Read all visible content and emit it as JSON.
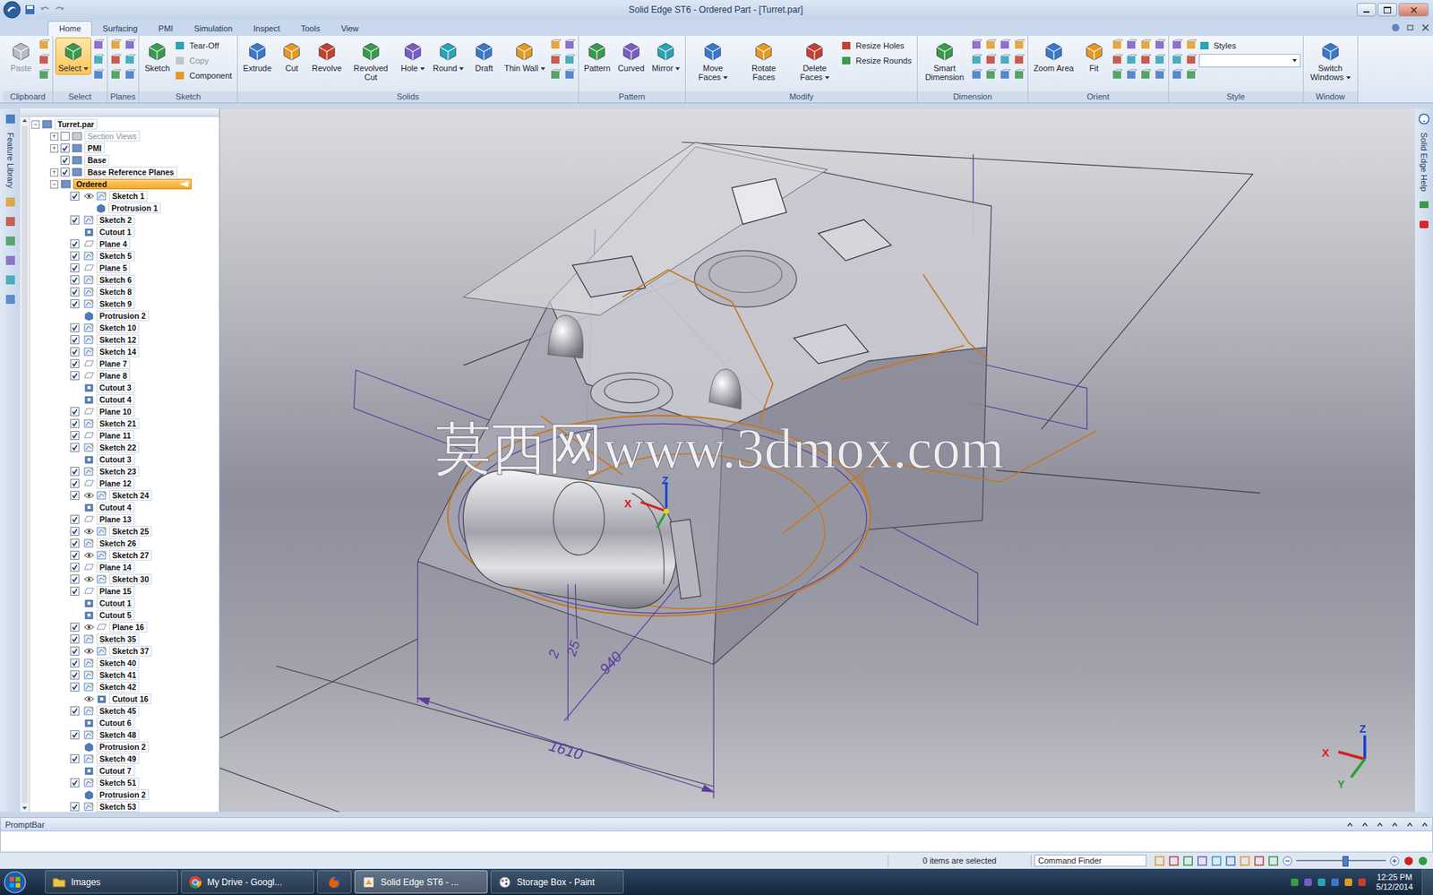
{
  "window": {
    "title": "Solid Edge ST6 - Ordered Part - [Turret.par]"
  },
  "ribbon_tabs": [
    {
      "label": "Home",
      "selected": true
    },
    {
      "label": "Surfacing",
      "selected": false
    },
    {
      "label": "PMI",
      "selected": false
    },
    {
      "label": "Simulation",
      "selected": false
    },
    {
      "label": "Inspect",
      "selected": false
    },
    {
      "label": "Tools",
      "selected": false
    },
    {
      "label": "View",
      "selected": false
    }
  ],
  "ribbon_groups": [
    {
      "label": "Clipboard",
      "items": [
        {
          "kind": "large",
          "label": "Paste",
          "disabled": true,
          "selected": false,
          "dropdown": false
        }
      ]
    },
    {
      "label": "Select",
      "items": [
        {
          "kind": "large",
          "label": "Select",
          "disabled": false,
          "selected": true,
          "dropdown": true
        }
      ]
    },
    {
      "label": "Planes",
      "items": []
    },
    {
      "label": "Sketch",
      "items": [
        {
          "kind": "large",
          "label": "Sketch",
          "disabled": false,
          "selected": false,
          "dropdown": false
        },
        {
          "kind": "small",
          "label": "Tear-Off",
          "disabled": false
        },
        {
          "kind": "small",
          "label": "Copy",
          "disabled": true
        },
        {
          "kind": "small",
          "label": "Component",
          "disabled": false
        }
      ]
    },
    {
      "label": "Solids",
      "items": [
        {
          "kind": "large",
          "label": "Extrude",
          "disabled": false,
          "selected": false,
          "dropdown": false
        },
        {
          "kind": "large",
          "label": "Cut",
          "disabled": false,
          "selected": false,
          "dropdown": false
        },
        {
          "kind": "large",
          "label": "Revolve",
          "disabled": false,
          "selected": false,
          "dropdown": false
        },
        {
          "kind": "large",
          "label": "Revolved Cut",
          "disabled": false,
          "selected": false,
          "dropdown": false
        },
        {
          "kind": "large",
          "label": "Hole",
          "disabled": false,
          "selected": false,
          "dropdown": true
        },
        {
          "kind": "large",
          "label": "Round",
          "disabled": false,
          "selected": false,
          "dropdown": true
        },
        {
          "kind": "large",
          "label": "Draft",
          "disabled": false,
          "selected": false,
          "dropdown": false
        },
        {
          "kind": "large",
          "label": "Thin Wall",
          "disabled": false,
          "selected": false,
          "dropdown": true
        }
      ]
    },
    {
      "label": "Pattern",
      "items": [
        {
          "kind": "large",
          "label": "Pattern",
          "disabled": false,
          "selected": false,
          "dropdown": false
        },
        {
          "kind": "large",
          "label": "Curved",
          "disabled": false,
          "selected": false,
          "dropdown": false
        },
        {
          "kind": "large",
          "label": "Mirror",
          "disabled": false,
          "selected": false,
          "dropdown": true
        }
      ]
    },
    {
      "label": "Modify",
      "items": [
        {
          "kind": "large",
          "label": "Move Faces",
          "disabled": false,
          "selected": false,
          "dropdown": true
        },
        {
          "kind": "large",
          "label": "Rotate Faces",
          "disabled": false,
          "selected": false,
          "dropdown": false
        },
        {
          "kind": "large",
          "label": "Delete Faces",
          "disabled": false,
          "selected": false,
          "dropdown": true
        },
        {
          "kind": "small",
          "label": "Resize Holes",
          "disabled": false
        },
        {
          "kind": "small",
          "label": "Resize Rounds",
          "disabled": false
        }
      ]
    },
    {
      "label": "Dimension",
      "items": [
        {
          "kind": "large",
          "label": "Smart Dimension",
          "disabled": false,
          "selected": false,
          "dropdown": false
        }
      ]
    },
    {
      "label": "Orient",
      "items": [
        {
          "kind": "large",
          "label": "Zoom Area",
          "disabled": false,
          "selected": false,
          "dropdown": false
        },
        {
          "kind": "large",
          "label": "Fit",
          "disabled": false,
          "selected": false,
          "dropdown": false
        }
      ]
    },
    {
      "label": "Style",
      "items": [
        {
          "kind": "small",
          "label": "Styles",
          "disabled": false
        },
        {
          "kind": "combo",
          "disabled": false
        }
      ]
    },
    {
      "label": "Window",
      "items": [
        {
          "kind": "large",
          "label": "Switch Windows",
          "disabled": false,
          "selected": false,
          "dropdown": true
        }
      ]
    }
  ],
  "left_strip": {
    "label": "Feature Library"
  },
  "right_strip": {
    "label": "Solid Edge Help"
  },
  "pathfinder": {
    "top": [
      {
        "label": "Turret.par",
        "expander": "−",
        "level": 0,
        "checkbox": false,
        "checked": false,
        "disabled": false,
        "selected": false
      },
      {
        "label": "Section Views",
        "expander": "+",
        "level": 1,
        "checkbox": true,
        "checked": false,
        "disabled": true,
        "selected": false
      },
      {
        "label": "PMI",
        "expander": "+",
        "level": 1,
        "checkbox": true,
        "checked": true,
        "disabled": false,
        "selected": false
      },
      {
        "label": "Base",
        "expander": "",
        "level": 1,
        "checkbox": true,
        "checked": true,
        "disabled": false,
        "selected": false
      },
      {
        "label": "Base Reference Planes",
        "expander": "+",
        "level": 1,
        "checkbox": true,
        "checked": true,
        "disabled": false,
        "selected": false
      },
      {
        "label": "Ordered",
        "expander": "−",
        "level": 1,
        "checkbox": false,
        "checked": false,
        "disabled": false,
        "selected": true
      }
    ],
    "features": [
      {
        "label": "Sketch 1",
        "type": "sketch",
        "checkbox": true,
        "checked": true,
        "eye": true,
        "indent": 0
      },
      {
        "label": "Protrusion 1",
        "type": "protrusion",
        "checkbox": false,
        "checked": false,
        "eye": false,
        "indent": 1
      },
      {
        "label": "Sketch 2",
        "type": "sketch",
        "checkbox": true,
        "checked": true,
        "eye": false,
        "indent": 0
      },
      {
        "label": "Cutout 1",
        "type": "cutout",
        "checkbox": false,
        "checked": false,
        "eye": false,
        "indent": 0
      },
      {
        "label": "Plane 4",
        "type": "plane",
        "checkbox": true,
        "checked": true,
        "eye": false,
        "indent": 0
      },
      {
        "label": "Sketch 5",
        "type": "sketch",
        "checkbox": true,
        "checked": true,
        "eye": false,
        "indent": 0
      },
      {
        "label": "Plane 5",
        "type": "plane",
        "checkbox": true,
        "checked": true,
        "eye": false,
        "indent": 0
      },
      {
        "label": "Sketch 6",
        "type": "sketch",
        "checkbox": true,
        "checked": true,
        "eye": false,
        "indent": 0
      },
      {
        "label": "Sketch 8",
        "type": "sketch",
        "checkbox": true,
        "checked": true,
        "eye": false,
        "indent": 0
      },
      {
        "label": "Sketch 9",
        "type": "sketch",
        "checkbox": true,
        "checked": true,
        "eye": false,
        "indent": 0
      },
      {
        "label": "Protrusion 2",
        "type": "protrusion",
        "checkbox": false,
        "checked": false,
        "eye": false,
        "indent": 0
      },
      {
        "label": "Sketch 10",
        "type": "sketch",
        "checkbox": true,
        "checked": true,
        "eye": false,
        "indent": 0
      },
      {
        "label": "Sketch 12",
        "type": "sketch",
        "checkbox": true,
        "checked": true,
        "eye": false,
        "indent": 0
      },
      {
        "label": "Sketch 14",
        "type": "sketch",
        "checkbox": true,
        "checked": true,
        "eye": false,
        "indent": 0
      },
      {
        "label": "Plane 7",
        "type": "plane",
        "checkbox": true,
        "checked": true,
        "eye": false,
        "indent": 0
      },
      {
        "label": "Plane 8",
        "type": "plane",
        "checkbox": true,
        "checked": true,
        "eye": false,
        "indent": 0
      },
      {
        "label": "Cutout 3",
        "type": "cutout",
        "checkbox": false,
        "checked": false,
        "eye": false,
        "indent": 0
      },
      {
        "label": "Cutout 4",
        "type": "cutout",
        "checkbox": false,
        "checked": false,
        "eye": false,
        "indent": 0
      },
      {
        "label": "Plane 10",
        "type": "plane",
        "checkbox": true,
        "checked": true,
        "eye": false,
        "indent": 0
      },
      {
        "label": "Sketch 21",
        "type": "sketch",
        "checkbox": true,
        "checked": true,
        "eye": false,
        "indent": 0
      },
      {
        "label": "Plane 11",
        "type": "plane",
        "checkbox": true,
        "checked": true,
        "eye": false,
        "indent": 0
      },
      {
        "label": "Sketch 22",
        "type": "sketch",
        "checkbox": true,
        "checked": true,
        "eye": false,
        "indent": 0
      },
      {
        "label": "Cutout 3",
        "type": "cutout",
        "checkbox": false,
        "checked": false,
        "eye": false,
        "indent": 0
      },
      {
        "label": "Sketch 23",
        "type": "sketch",
        "checkbox": true,
        "checked": true,
        "eye": false,
        "indent": 0
      },
      {
        "label": "Plane 12",
        "type": "plane",
        "checkbox": true,
        "checked": true,
        "eye": false,
        "indent": 0
      },
      {
        "label": "Sketch 24",
        "type": "sketch",
        "checkbox": true,
        "checked": true,
        "eye": true,
        "indent": 0
      },
      {
        "label": "Cutout 4",
        "type": "cutout",
        "checkbox": false,
        "checked": false,
        "eye": false,
        "indent": 0
      },
      {
        "label": "Plane 13",
        "type": "plane",
        "checkbox": true,
        "checked": true,
        "eye": false,
        "indent": 0
      },
      {
        "label": "Sketch 25",
        "type": "sketch",
        "checkbox": true,
        "checked": true,
        "eye": true,
        "indent": 0
      },
      {
        "label": "Sketch 26",
        "type": "sketch",
        "checkbox": true,
        "checked": true,
        "eye": false,
        "indent": 0
      },
      {
        "label": "Sketch 27",
        "type": "sketch",
        "checkbox": true,
        "checked": true,
        "eye": true,
        "indent": 0
      },
      {
        "label": "Plane 14",
        "type": "plane",
        "checkbox": true,
        "checked": true,
        "eye": false,
        "indent": 0
      },
      {
        "label": "Sketch 30",
        "type": "sketch",
        "checkbox": true,
        "checked": true,
        "eye": true,
        "indent": 0
      },
      {
        "label": "Plane 15",
        "type": "plane",
        "checkbox": true,
        "checked": true,
        "eye": false,
        "indent": 0
      },
      {
        "label": "Cutout 1",
        "type": "cutout",
        "checkbox": false,
        "checked": false,
        "eye": false,
        "indent": 0
      },
      {
        "label": "Cutout 5",
        "type": "cutout",
        "checkbox": false,
        "checked": false,
        "eye": false,
        "indent": 0
      },
      {
        "label": "Plane 16",
        "type": "plane",
        "checkbox": true,
        "checked": true,
        "eye": true,
        "indent": 0
      },
      {
        "label": "Sketch 35",
        "type": "sketch",
        "checkbox": true,
        "checked": true,
        "eye": false,
        "indent": 0
      },
      {
        "label": "Sketch 37",
        "type": "sketch",
        "checkbox": true,
        "checked": true,
        "eye": true,
        "indent": 0
      },
      {
        "label": "Sketch 40",
        "type": "sketch",
        "checkbox": true,
        "checked": true,
        "eye": false,
        "indent": 0
      },
      {
        "label": "Sketch 41",
        "type": "sketch",
        "checkbox": true,
        "checked": true,
        "eye": false,
        "indent": 0
      },
      {
        "label": "Sketch 42",
        "type": "sketch",
        "checkbox": true,
        "checked": true,
        "eye": false,
        "indent": 0
      },
      {
        "label": "Cutout 16",
        "type": "cutout",
        "checkbox": false,
        "checked": false,
        "eye": true,
        "indent": 0
      },
      {
        "label": "Sketch 45",
        "type": "sketch",
        "checkbox": true,
        "checked": true,
        "eye": false,
        "indent": 0
      },
      {
        "label": "Cutout 6",
        "type": "cutout",
        "checkbox": false,
        "checked": false,
        "eye": false,
        "indent": 0
      },
      {
        "label": "Sketch 48",
        "type": "sketch",
        "checkbox": true,
        "checked": true,
        "eye": false,
        "indent": 0
      },
      {
        "label": "Protrusion 2",
        "type": "protrusion",
        "checkbox": false,
        "checked": false,
        "eye": false,
        "indent": 0
      },
      {
        "label": "Sketch 49",
        "type": "sketch",
        "checkbox": true,
        "checked": true,
        "eye": false,
        "indent": 0
      },
      {
        "label": "Cutout 7",
        "type": "cutout",
        "checkbox": false,
        "checked": false,
        "eye": false,
        "indent": 0
      },
      {
        "label": "Sketch 51",
        "type": "sketch",
        "checkbox": true,
        "checked": true,
        "eye": false,
        "indent": 0
      },
      {
        "label": "Protrusion 2",
        "type": "protrusion",
        "checkbox": false,
        "checked": false,
        "eye": false,
        "indent": 0
      },
      {
        "label": "Sketch 53",
        "type": "sketch",
        "checkbox": true,
        "checked": true,
        "eye": false,
        "indent": 0
      }
    ]
  },
  "viewport": {
    "watermark": "莫西网www.3dmox.com",
    "dimensions": [
      {
        "text": "1610"
      },
      {
        "text": "940"
      },
      {
        "text": "25"
      },
      {
        "text": "2"
      }
    ],
    "model_triad": {
      "x": "X",
      "z": "Z"
    },
    "view_triad": {
      "x": "X",
      "y": "Y",
      "z": "Z"
    }
  },
  "prompt_bar": {
    "title": "PromptBar"
  },
  "status_bar": {
    "selection": "0 items are selected",
    "command_finder": "Command Finder",
    "zoom_level": 0.54
  },
  "taskbar": {
    "buttons": [
      {
        "label": "Images",
        "active": false
      },
      {
        "label": "My Drive - Googl...",
        "active": false
      },
      {
        "active": false
      },
      {
        "label": "Solid Edge ST6 - ...",
        "active": true
      },
      {
        "label": "Storage Box - Paint",
        "active": false
      }
    ],
    "time": "12:25 PM",
    "date": "5/12/2014"
  }
}
